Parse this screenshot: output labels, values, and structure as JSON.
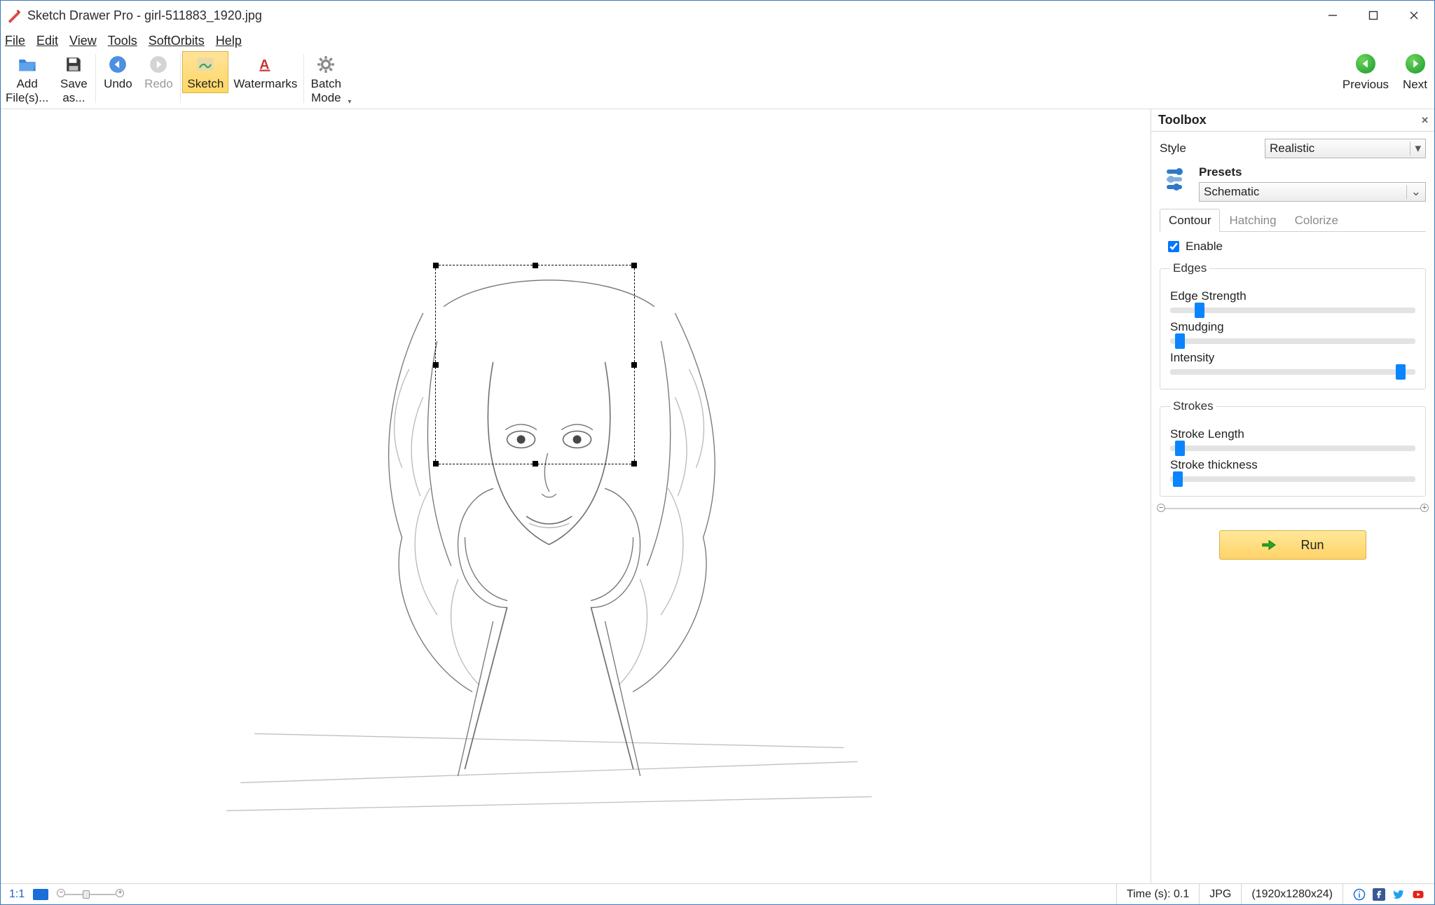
{
  "window": {
    "title": "Sketch Drawer Pro - girl-511883_1920.jpg"
  },
  "menu": {
    "file": "File",
    "edit": "Edit",
    "view": "View",
    "tools": "Tools",
    "softorbits": "SoftOrbits",
    "help": "Help"
  },
  "toolbar": {
    "add_files": "Add\nFile(s)...",
    "save_as": "Save\nas...",
    "undo": "Undo",
    "redo": "Redo",
    "sketch": "Sketch",
    "watermarks": "Watermarks",
    "batch_mode": "Batch\nMode",
    "previous": "Previous",
    "next": "Next"
  },
  "toolbox": {
    "title": "Toolbox",
    "style_label": "Style",
    "style_value": "Realistic",
    "presets_label": "Presets",
    "presets_value": "Schematic",
    "tab_contour": "Contour",
    "tab_hatching": "Hatching",
    "tab_colorize": "Colorize",
    "enable_label": "Enable",
    "edges_group": "Edges",
    "edge_strength": "Edge Strength",
    "smudging": "Smudging",
    "intensity": "Intensity",
    "strokes_group": "Strokes",
    "stroke_length": "Stroke Length",
    "stroke_thickness": "Stroke thickness",
    "run": "Run"
  },
  "sliders": {
    "edge_strength_pct": 10,
    "smudging_pct": 2,
    "intensity_pct": 92,
    "stroke_length_pct": 2,
    "stroke_thickness_pct": 1
  },
  "status": {
    "ratio": "1:1",
    "time": "Time (s): 0.1",
    "format": "JPG",
    "dimensions": "(1920x1280x24)"
  }
}
